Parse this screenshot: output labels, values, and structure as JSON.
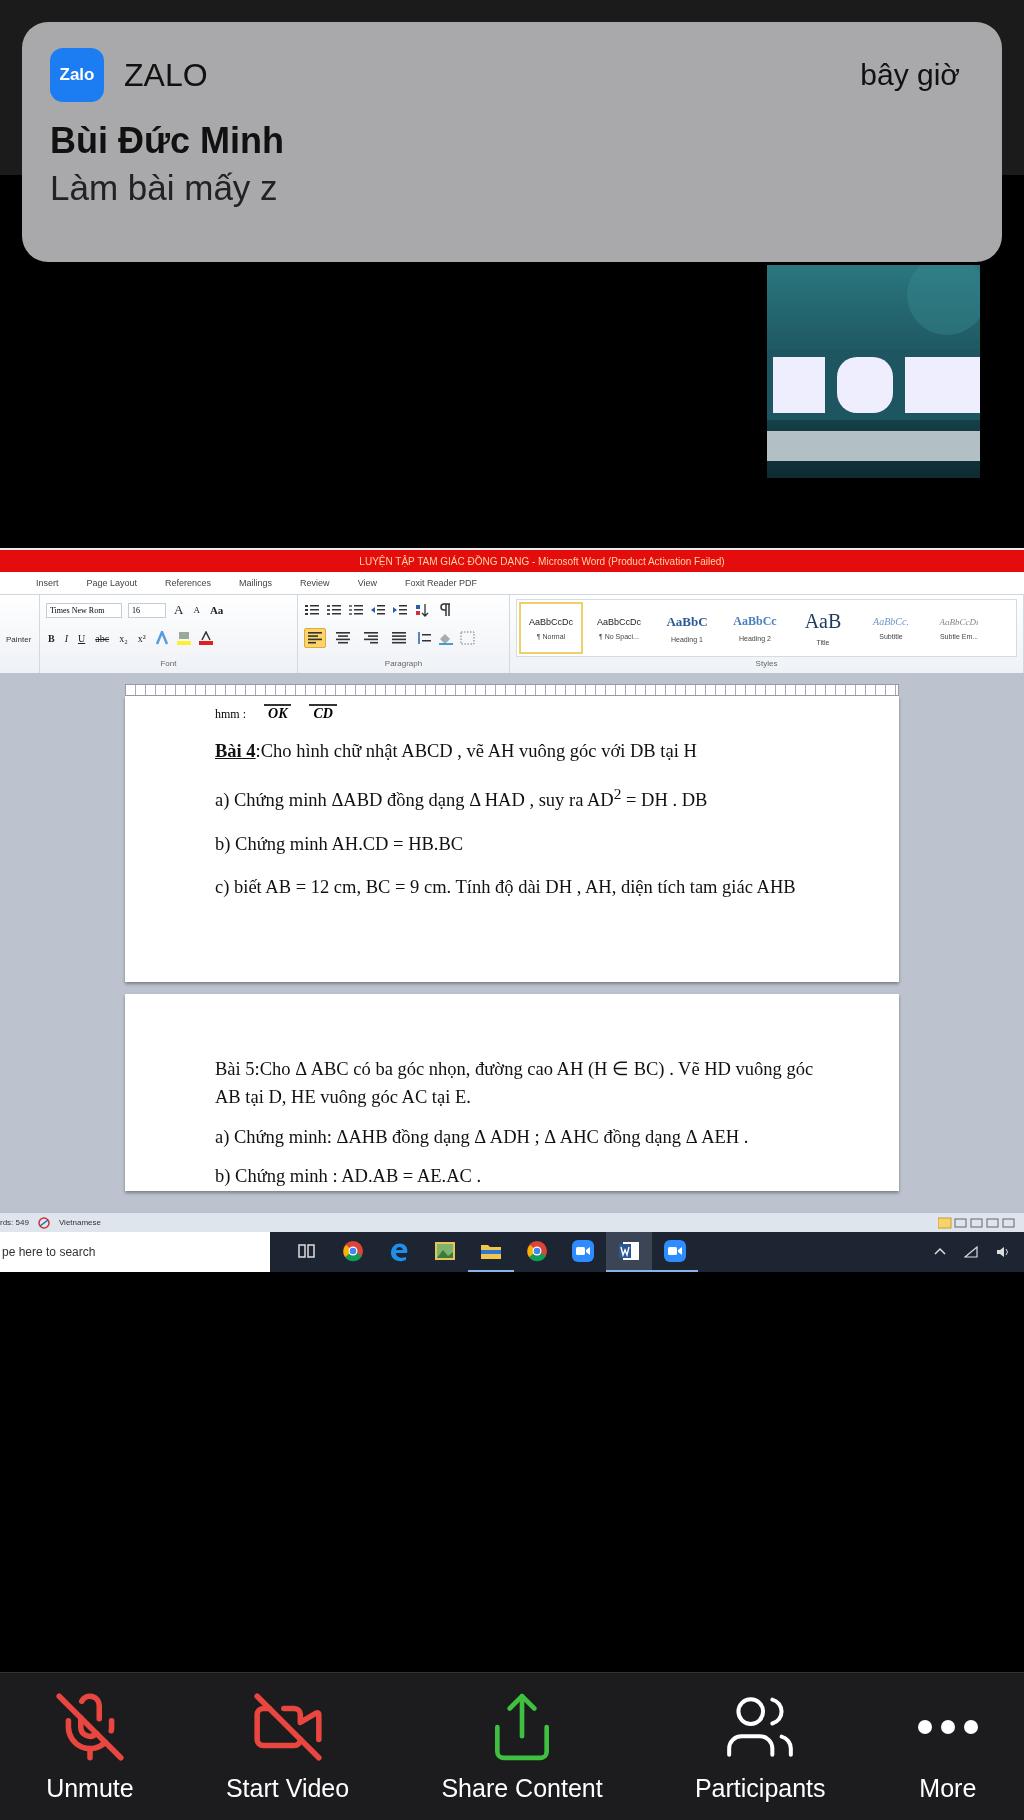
{
  "notification": {
    "app_icon_text": "Zalo",
    "app": "ZALO",
    "time": "bây giờ",
    "sender": "Bùi Đức Minh",
    "message": "Làm bài mấy z"
  },
  "shared_screen": {
    "title": "LUYỆN TẬP TAM GIÁC ĐỒNG DẠNG  -  Microsoft Word (Product Activation Failed)",
    "tabs": [
      {
        "label": "Insert",
        "selected": false
      },
      {
        "label": "Page Layout",
        "selected": false
      },
      {
        "label": "References",
        "selected": false
      },
      {
        "label": "Mailings",
        "selected": false
      },
      {
        "label": "Review",
        "selected": false
      },
      {
        "label": "View",
        "selected": false
      },
      {
        "label": "Foxit Reader PDF",
        "selected": false
      }
    ],
    "clipboard_label": "Painter",
    "font_name": "Times New Rom",
    "font_size": "16",
    "font_row1": [
      {
        "label": "A",
        "kind": "grow"
      },
      {
        "label": "A",
        "kind": "shrink"
      },
      {
        "label": "Aa",
        "kind": "case"
      }
    ],
    "font_row2": [
      {
        "label": "B",
        "kind": "bold"
      },
      {
        "label": "I",
        "kind": "italic"
      },
      {
        "label": "U",
        "kind": "underline"
      },
      {
        "label": "abc",
        "kind": "strike"
      },
      {
        "label": "x₂",
        "kind": "sub"
      },
      {
        "label": "x²",
        "kind": "super"
      }
    ],
    "alignments": [
      {
        "kind": "left",
        "selected": true
      },
      {
        "kind": "center",
        "selected": false
      },
      {
        "kind": "right",
        "selected": false
      },
      {
        "kind": "justify",
        "selected": false
      }
    ],
    "groups": [
      "Font",
      "Paragraph",
      "Styles"
    ],
    "styles": [
      {
        "preview": "AaBbCcDc",
        "label": "¶ Normal",
        "kind": "normal",
        "selected": true
      },
      {
        "preview": "AaBbCcDc",
        "label": "¶ No Spaci...",
        "kind": "normal",
        "selected": false
      },
      {
        "preview": "AaBbC",
        "label": "Heading 1",
        "kind": "heading1",
        "selected": false
      },
      {
        "preview": "AaBbCc",
        "label": "Heading 2",
        "kind": "heading2",
        "selected": false
      },
      {
        "preview": "AaB",
        "label": "Title",
        "kind": "title",
        "selected": false
      },
      {
        "preview": "AaBbCc.",
        "label": "Subtitle",
        "kind": "subtitle",
        "selected": false
      },
      {
        "preview": "AaBbCcDı",
        "label": "Subtle Em...",
        "kind": "subtle",
        "selected": false
      }
    ],
    "pages": [
      {
        "cut_line": {
          "prefix": "hmm :",
          "denominators": [
            "OK",
            "CD"
          ]
        },
        "paragraphs": [
          "**Bài 4**:Cho hình chữ nhật ABCD , vẽ AH vuông góc với  DB tại H",
          "a) Chứng minh ΔABD đồng dạng  Δ HAD , suy ra AD$^{2}$  = DH . DB",
          "b) Chứng minh AH.CD = HB.BC",
          "c) biết AB = 12 cm, BC = 9 cm. Tính độ dài DH , AH,  diện tích tam giác AHB"
        ]
      },
      {
        "paragraphs": [
          "Bài 5:Cho Δ ABC có ba góc nhọn, đường cao AH (H ∈ BC) . Vẽ HD vuông góc AB tại D, HE vuông góc AC tại E.",
          "a) Chứng minh: ΔAHB đồng dạng Δ ADH ; Δ AHC đồng dạng Δ AEH .",
          "b) Chứng minh : AD.AB = AE.AC ."
        ]
      }
    ],
    "status_bar": {
      "words": "rds: 549",
      "language": "Vietnamese"
    },
    "taskbar": {
      "search_placeholder": "pe here to search",
      "apps": [
        {
          "kind": "taskview",
          "open": false,
          "selected": false
        },
        {
          "kind": "chrome",
          "open": false,
          "selected": false
        },
        {
          "kind": "edge",
          "open": false,
          "selected": false
        },
        {
          "kind": "photos",
          "open": false,
          "selected": false
        },
        {
          "kind": "explorer",
          "open": true,
          "selected": false
        },
        {
          "kind": "chrome",
          "open": false,
          "selected": false
        },
        {
          "kind": "zoom",
          "open": false,
          "selected": false
        },
        {
          "kind": "word",
          "open": true,
          "selected": true
        },
        {
          "kind": "zoom",
          "open": true,
          "selected": false
        }
      ]
    }
  },
  "toolbar": [
    {
      "label": "Unmute",
      "kind": "mic",
      "off": true
    },
    {
      "label": "Start Video",
      "kind": "video",
      "off": true
    },
    {
      "label": "Share Content",
      "kind": "share",
      "off": false
    },
    {
      "label": "Participants",
      "kind": "participants",
      "off": false
    },
    {
      "label": "More",
      "kind": "more",
      "off": false
    }
  ]
}
